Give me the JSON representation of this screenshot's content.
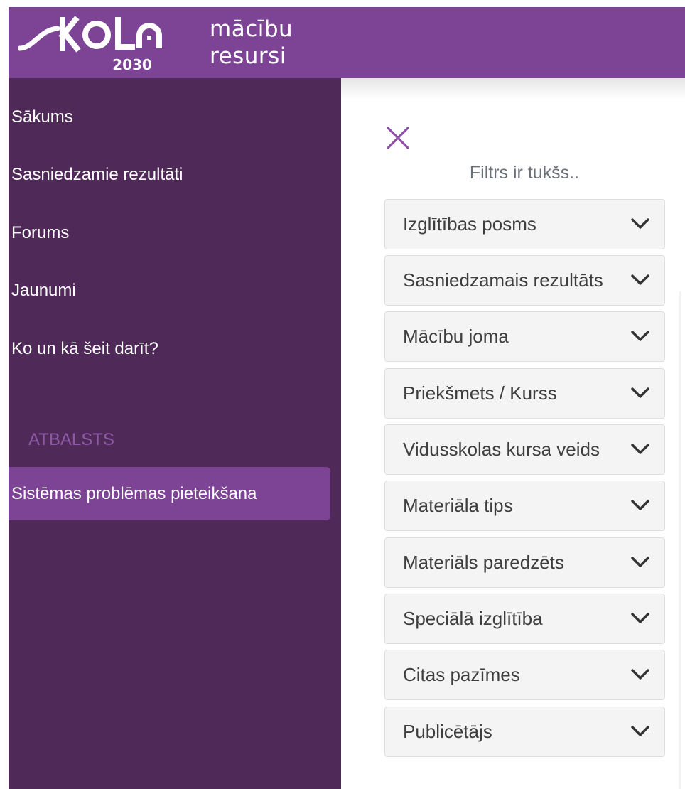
{
  "header": {
    "logo_word": "SKOLA",
    "logo_year": "2030",
    "subtitle_line1": "mācību",
    "subtitle_line2": "resursi",
    "brand_color": "#7d4496"
  },
  "sidebar": {
    "bg_color": "#4f2958",
    "items": [
      {
        "label": "Sākums"
      },
      {
        "label": "Sasniedzamie rezultāti"
      },
      {
        "label": "Forums"
      },
      {
        "label": "Jaunumi"
      },
      {
        "label": "Ko un kā šeit darīt?"
      }
    ],
    "section_label": "ATBALSTS",
    "support_item": "Sistēmas problēmas pieteikšana"
  },
  "filters": {
    "close_icon": "close-icon",
    "empty_text": "Filtrs ir tukšs..",
    "items": [
      {
        "label": "Izglītības posms"
      },
      {
        "label": "Sasniedzamais rezultāts"
      },
      {
        "label": "Mācību joma"
      },
      {
        "label": "Priekšmets / Kurss"
      },
      {
        "label": "Vidusskolas kursa veids"
      },
      {
        "label": "Materiāla tips"
      },
      {
        "label": "Materiāls paredzēts"
      },
      {
        "label": "Speciālā izglītība"
      },
      {
        "label": "Citas pazīmes"
      },
      {
        "label": "Publicētājs"
      }
    ]
  }
}
